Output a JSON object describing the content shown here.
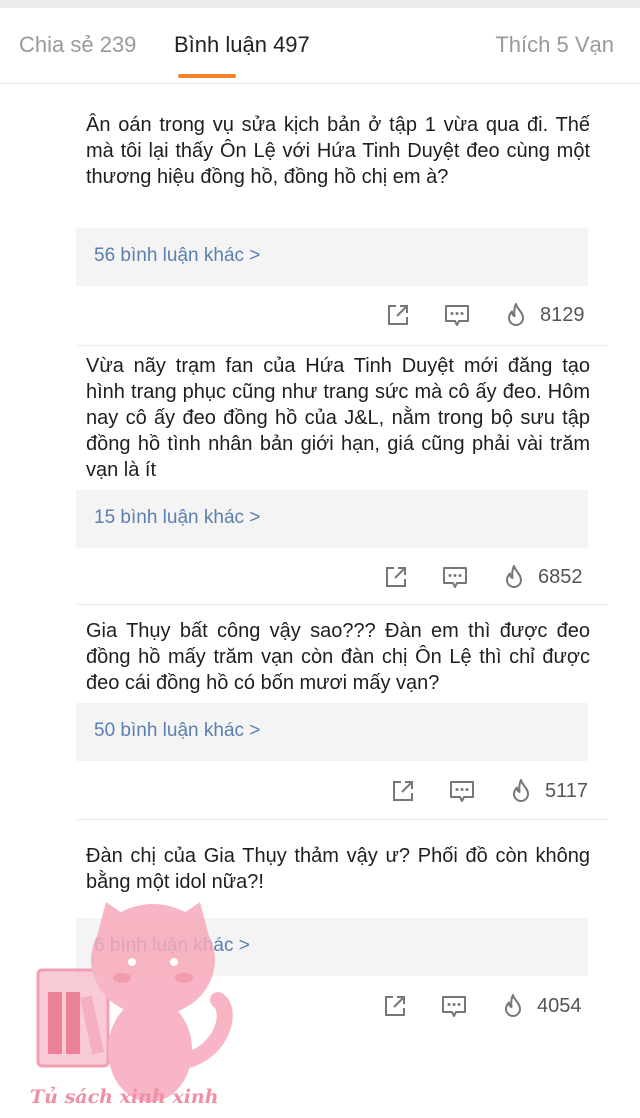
{
  "tabs": {
    "share": "Chia sẻ 239",
    "comments": "Bình luận 497",
    "likes": "Thích 5 Vạn"
  },
  "colors": {
    "accent": "#f0832b",
    "link": "#5b7fb0",
    "reply_bg": "#f4f4f4"
  },
  "comments": [
    {
      "text": "Ân oán trong vụ sửa kịch bản ở tập 1 vừa qua đi. Thế mà tôi lại thấy Ôn Lệ với Hứa Tinh Duyệt đeo cùng một thương hiệu đồng hồ, đồng hồ chị em à?",
      "replies": "56 bình luận khác >",
      "heat": "8129"
    },
    {
      "text": "Vừa nãy trạm fan của Hứa Tinh Duyệt mới đăng tạo hình trang phục cũng như trang sức mà cô ấy đeo. Hôm nay cô ấy đeo đồng hồ của J&L, nằm trong bộ sưu tập đồng hồ tình nhân bản giới hạn, giá cũng phải vài trăm vạn là ít",
      "replies": "15 bình luận khác >",
      "heat": "6852"
    },
    {
      "text": "Gia Thụy bất công vậy sao??? Đàn em thì được đeo đồng hồ mấy trăm vạn còn đàn chị Ôn Lệ thì chỉ được đeo cái đồng hồ có bốn mươi mấy vạn?",
      "replies": "50 bình luận khác >",
      "heat": "5117"
    },
    {
      "text": "Đàn chị của Gia Thụy thảm vậy ư? Phối đồ còn không bằng một idol nữa?!",
      "replies": "6 bình luận khác >",
      "heat": "4054"
    }
  ],
  "icons": {
    "share": "share-box-arrow-icon",
    "reply": "comment-bubble-icon",
    "heat": "flame-icon"
  },
  "watermark": {
    "text": "Tủ sách xinh xinh"
  }
}
